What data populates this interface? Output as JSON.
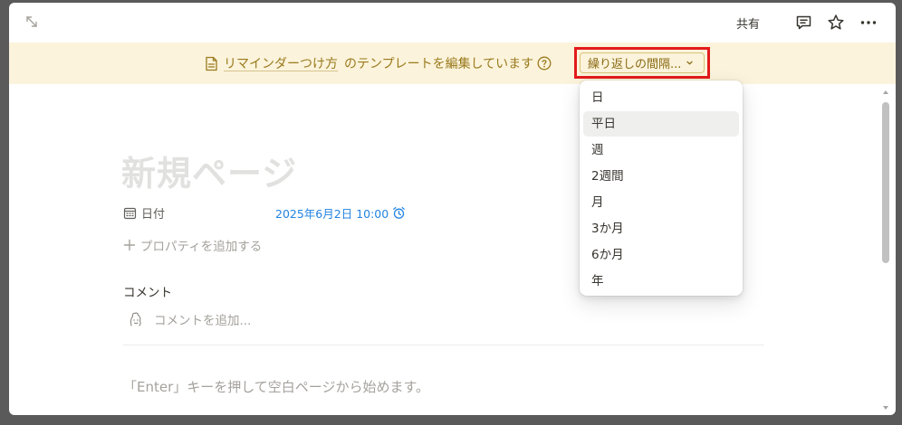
{
  "topbar": {
    "share_label": "共有"
  },
  "banner": {
    "page_link": "リマインダーつけ方",
    "message": "のテンプレートを編集しています",
    "repeat_button_label": "繰り返しの間隔..."
  },
  "page": {
    "title": "新規ページ",
    "properties": [
      {
        "label": "日付",
        "value": "2025年6月2日 10:00"
      }
    ],
    "add_property_label": "プロパティを追加する",
    "comments_title": "コメント",
    "comment_placeholder": "コメントを追加...",
    "empty_hint": "「Enter」キーを押して空白ページから始めます。"
  },
  "repeat_menu": {
    "items": [
      "日",
      "平日",
      "週",
      "2週間",
      "月",
      "3か月",
      "6か月",
      "年"
    ],
    "hovered_index": 1
  },
  "colors": {
    "banner_bg": "#fbf3db",
    "banner_text": "#9a7a1d",
    "highlight_border": "#e31b1b",
    "date_value": "#2383e2"
  }
}
